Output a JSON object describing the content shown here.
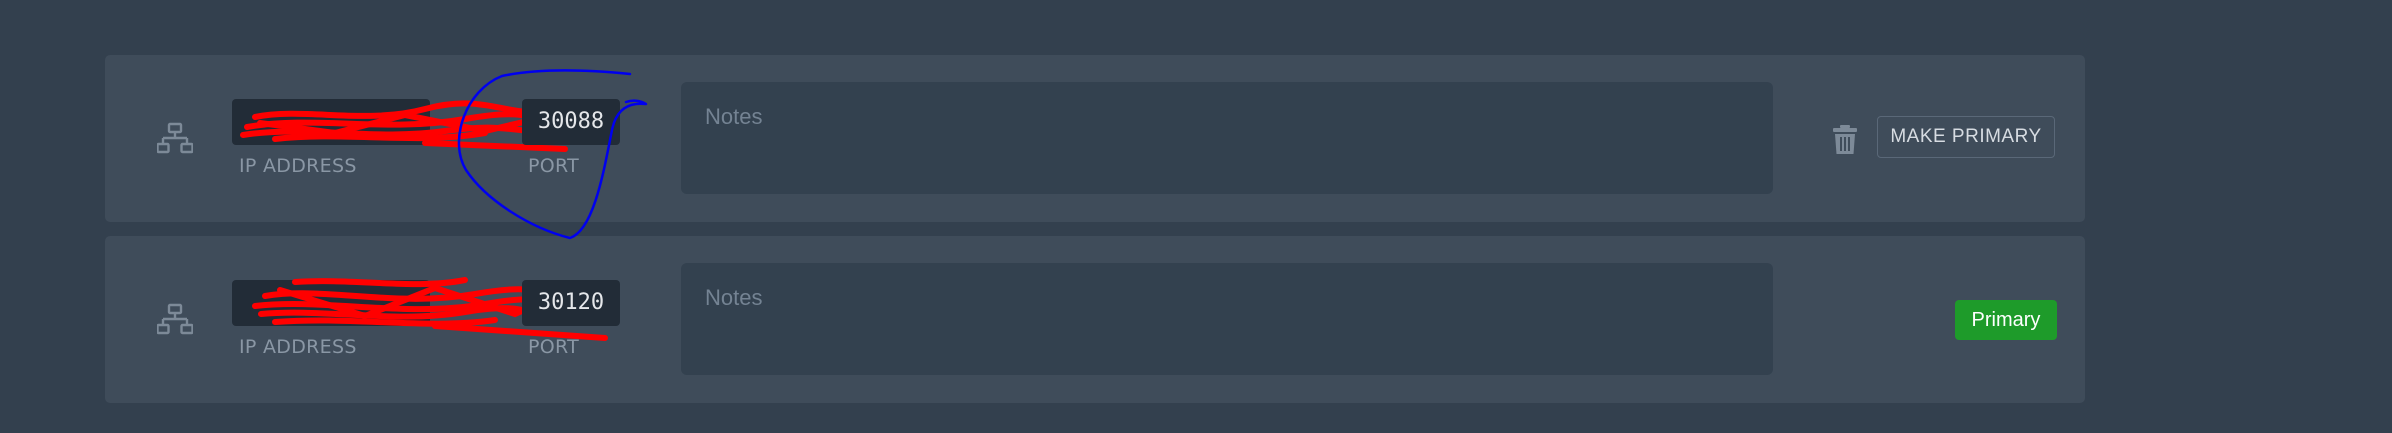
{
  "allocations": [
    {
      "ip_value": "",
      "ip_label": "IP ADDRESS",
      "port_value": "30088",
      "port_label": "PORT",
      "notes_placeholder": "Notes",
      "action_label": "MAKE PRIMARY",
      "is_primary": false,
      "icons": [
        "network-icon",
        "trash-icon"
      ]
    },
    {
      "ip_value": "",
      "ip_label": "IP ADDRESS",
      "port_value": "30120",
      "port_label": "PORT",
      "notes_placeholder": "Notes",
      "badge_label": "Primary",
      "is_primary": true,
      "icons": [
        "network-icon"
      ]
    }
  ],
  "colors": {
    "page_background": "#33404e",
    "row_background": "#3f4c5a",
    "field_background": "#222c37",
    "notes_background": "#33414f",
    "primary_badge": "#1e9b2a",
    "redaction_marker": "#ff0000",
    "annotation_marker": "#0000ee"
  }
}
